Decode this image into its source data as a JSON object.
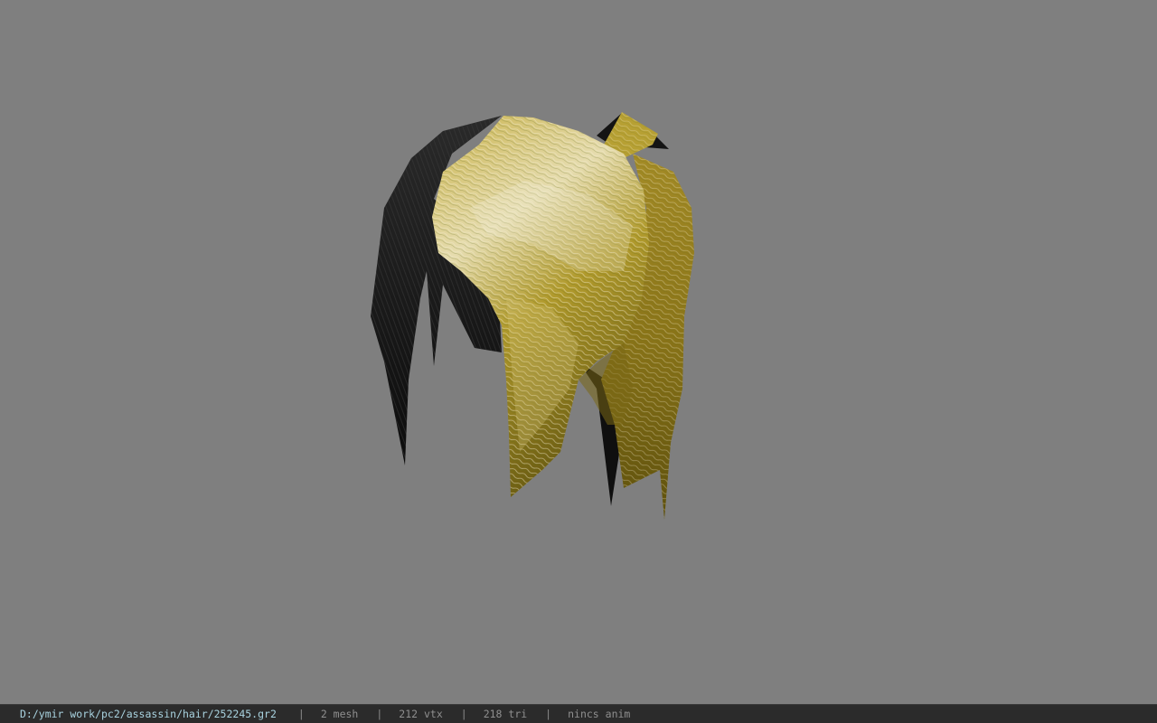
{
  "status_bar": {
    "file_path": "D:/ymir work/pc2/assassin/hair/252245.gr2",
    "separator": "|",
    "mesh_count": "2 mesh",
    "vertex_count": "212 vtx",
    "triangle_count": "218 tri",
    "anim_status": "nincs anim"
  },
  "viewport": {
    "background_color": "#7f7f7f",
    "model": "hair-model"
  }
}
